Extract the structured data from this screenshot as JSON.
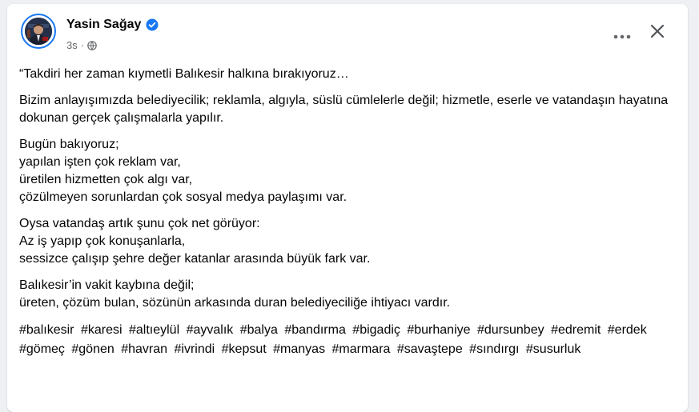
{
  "post": {
    "author": "Yasin Sağay",
    "time": "3s",
    "paragraphs": [
      "“Takdiri her zaman kıymetli Balıkesir halkına bırakıyoruz…",
      "Bizim anlayışımızda belediyecilik; reklamla, algıyla, süslü cümlelerle değil; hizmetle, eserle ve vatandaşın hayatına dokunan gerçek çalışmalarla yapılır.",
      "Bugün bakıyoruz;\nyapılan işten çok reklam var,\nüretilen hizmetten çok algı var,\nçözülmeyen sorunlardan çok sosyal medya paylaşımı var.",
      "Oysa vatandaş artık şunu çok net görüyor:\nAz iş yapıp çok konuşanlarla,\nsessizce çalışıp şehre değer katanlar arasında büyük fark var.",
      "Balıkesir’in vakit kaybına değil;\nüreten, çözüm bulan, sözünün arkasında duran belediyeciliğe ihtiyacı vardır."
    ],
    "hashtags": [
      "#balıkesir",
      "#karesi",
      "#altıeylül",
      "#ayvalık",
      "#balya",
      "#bandırma",
      "#bigadiç",
      "#burhaniye",
      "#dursunbey",
      "#edremit",
      "#erdek",
      "#gömeç",
      "#gönen",
      "#havran",
      "#ivrindi",
      "#kepsut",
      "#manyas",
      "#marmara",
      "#savaştepe",
      "#sındırgı",
      "#susurluk"
    ]
  },
  "icons": {
    "verified": "verified-badge-icon",
    "privacy": "globe-icon",
    "more": "more-horizontal-icon",
    "close": "close-icon"
  },
  "colors": {
    "accent": "#1877f2",
    "text": "#050505",
    "secondary": "#65676b"
  }
}
